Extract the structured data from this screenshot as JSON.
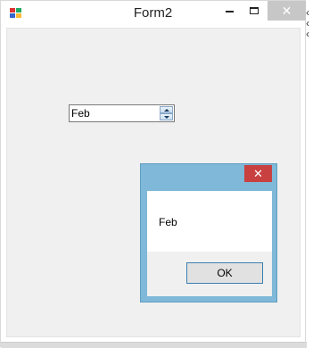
{
  "window": {
    "title": "Form2",
    "close_glyph": "✕",
    "icons": [
      "app-icon",
      "minimize-icon",
      "maximize-icon",
      "close-icon"
    ]
  },
  "form": {
    "updown_value": "Feb"
  },
  "message_box": {
    "text": "Feb",
    "ok_label": "OK",
    "close_glyph": "✕"
  },
  "colors": {
    "client_bg": "#f0f0f0",
    "msgbox_border": "#7fb8d8",
    "msgbox_close": "#c94040",
    "ok_border": "#3c7fb1"
  }
}
